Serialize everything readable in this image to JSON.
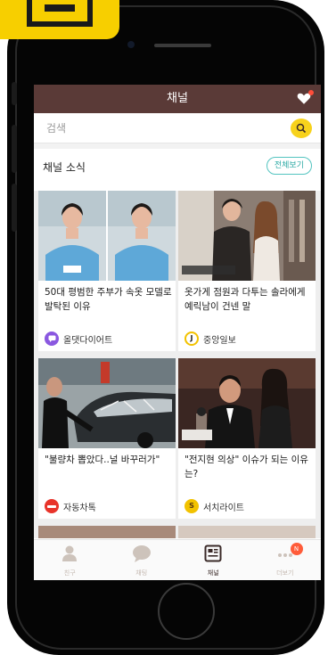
{
  "app": {
    "title": "채널"
  },
  "search": {
    "placeholder": "검색"
  },
  "section": {
    "title": "채널 소식",
    "see_all_label": "전체보기"
  },
  "cards": [
    {
      "title": "50대 평범한 주부가 속옷 모델로 발탁된 이유",
      "source": "올댓다이어트",
      "source_icon": "chat-bubble-icon",
      "source_color": "#8a58e0"
    },
    {
      "title": "옷가게 점원과 다투는 솔라에게 예릭남이 건넨 말",
      "source": "중앙일보",
      "source_icon": "joongang-j-icon",
      "source_color": "#f2c200"
    },
    {
      "title": "\"불량차 뽑았다..널 바꾸러가\"",
      "source": "자동차톡",
      "source_icon": "car-talk-logo-icon",
      "source_color": "#e8332a"
    },
    {
      "title": "\"전지현 의상\" 이슈가 되는 이유는?",
      "source": "서치라이트",
      "source_icon": "searchlight-s-icon",
      "source_color": "#f2c200"
    }
  ],
  "tabs": [
    {
      "label": "친구",
      "icon": "person-icon"
    },
    {
      "label": "채팅",
      "icon": "speech-bubble-icon"
    },
    {
      "label": "채널",
      "icon": "channel-grid-icon"
    },
    {
      "label": "더보기",
      "icon": "more-dots-icon",
      "badge": "N"
    }
  ],
  "colors": {
    "header_bg": "#5a3a37",
    "search_accent": "#f7d21c",
    "see_all_accent": "#53c4c0",
    "badge": "#ff5c3a",
    "frame_chip": "#f7cf00"
  }
}
